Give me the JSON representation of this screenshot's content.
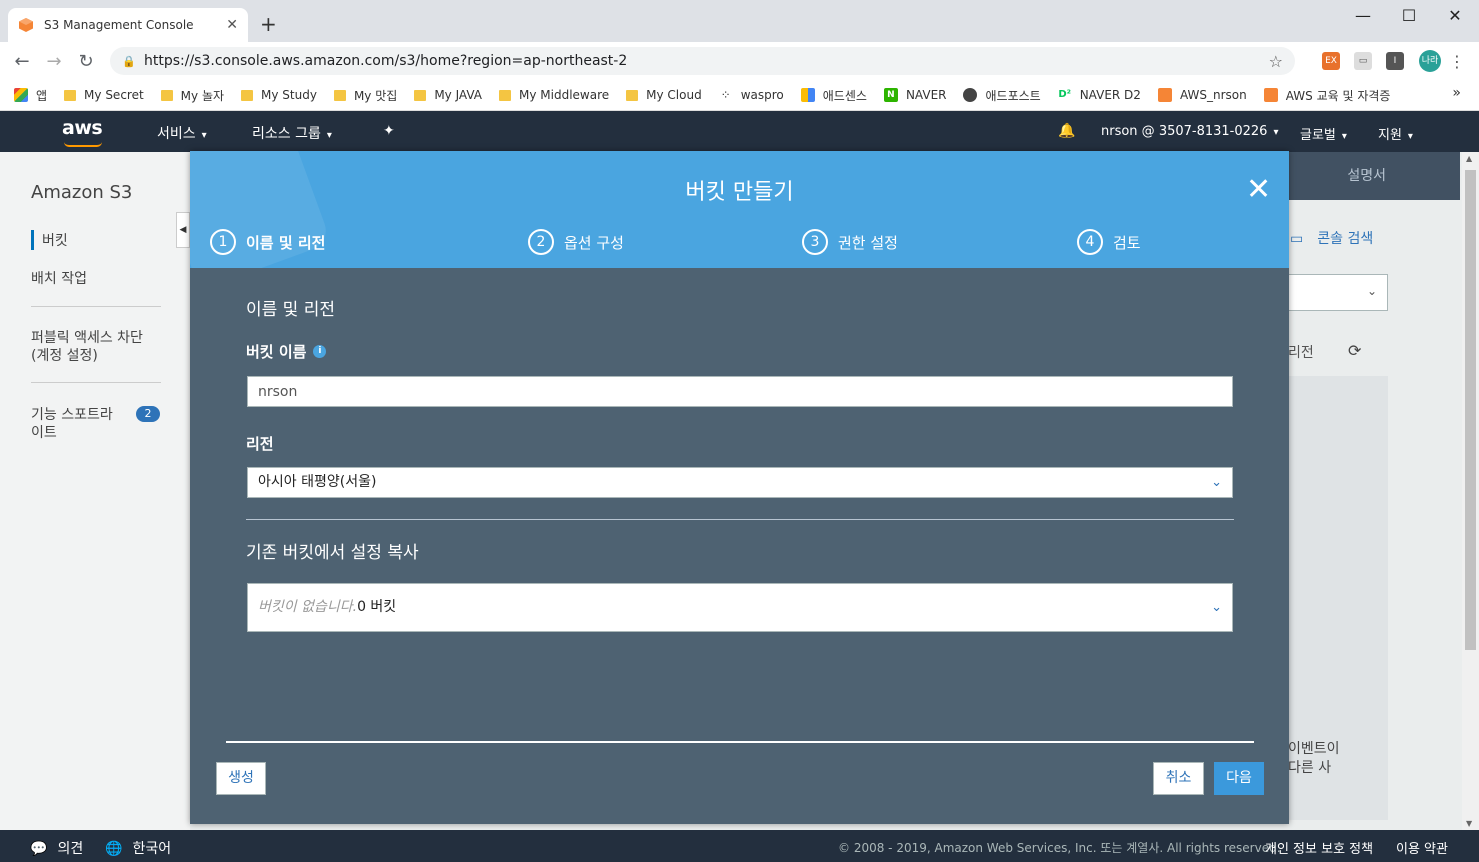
{
  "browser": {
    "tab_title": "S3 Management Console",
    "url": "https://s3.console.aws.amazon.com/s3/home?region=ap-northeast-2",
    "profile_label": "나라",
    "bookmarks": [
      {
        "label": "앱",
        "type": "apps"
      },
      {
        "label": "My Secret",
        "type": "folder"
      },
      {
        "label": "My 놀자",
        "type": "folder"
      },
      {
        "label": "My Study",
        "type": "folder"
      },
      {
        "label": "My 맛집",
        "type": "folder"
      },
      {
        "label": "My JAVA",
        "type": "folder"
      },
      {
        "label": "My Middleware",
        "type": "folder"
      },
      {
        "label": "My Cloud",
        "type": "folder"
      },
      {
        "label": "waspro",
        "type": "site"
      },
      {
        "label": "애드센스",
        "type": "site"
      },
      {
        "label": "NAVER",
        "type": "site"
      },
      {
        "label": "애드포스트",
        "type": "site"
      },
      {
        "label": "NAVER D2",
        "type": "site"
      },
      {
        "label": "AWS_nrson",
        "type": "site"
      },
      {
        "label": "AWS 교육 및 자격증",
        "type": "site"
      }
    ],
    "more": "»"
  },
  "aws_nav": {
    "logo": "aws",
    "services": "서비스",
    "resource_groups": "리소스 그룹",
    "account": "nrson @ 3507-8131-0226",
    "region": "글로벌",
    "support": "지원"
  },
  "sidebar": {
    "title": "Amazon S3",
    "items": [
      "버킷",
      "배치 작업",
      "퍼블릭 액세스 차단",
      "(계정 설정)",
      "기능 스포트라",
      "이트"
    ],
    "badge": "2"
  },
  "background": {
    "docs_tab": "설명서",
    "console_search": "콘솔 검색",
    "region_text": "리전",
    "text1": "이벤트이",
    "text2": "다른 사"
  },
  "modal": {
    "title": "버킷 만들기",
    "steps": [
      {
        "num": "1",
        "label": "이름 및 리전"
      },
      {
        "num": "2",
        "label": "옵션 구성"
      },
      {
        "num": "3",
        "label": "권한 설정"
      },
      {
        "num": "4",
        "label": "검토"
      }
    ],
    "section_title": "이름 및 리전",
    "bucket_name_label": "버킷 이름",
    "bucket_name_value": "nrson",
    "region_label": "리전",
    "region_value": "아시아 태평양(서울)",
    "copy_title": "기존 버킷에서 설정 복사",
    "copy_placeholder": "버킷이 없습니다.",
    "copy_count": "0 버킷",
    "create_button": "생성",
    "cancel_button": "취소",
    "next_button": "다음"
  },
  "footer": {
    "feedback": "의견",
    "language": "한국어",
    "copyright": "© 2008 - 2019, Amazon Web Services, Inc. 또는 계열사. All rights reserved.",
    "privacy": "개인 정보 보호 정책",
    "terms": "이용 약관"
  }
}
